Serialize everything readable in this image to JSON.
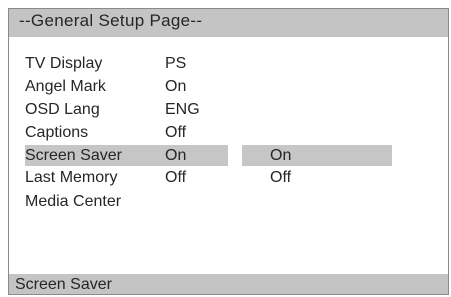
{
  "title": "--General Setup Page--",
  "menu": [
    {
      "label": "TV Display",
      "value": "PS"
    },
    {
      "label": "Angel Mark",
      "value": "On"
    },
    {
      "label": "OSD Lang",
      "value": "ENG"
    },
    {
      "label": "Captions",
      "value": "Off"
    },
    {
      "label": "Screen Saver",
      "value": "On"
    },
    {
      "label": "Last Memory",
      "value": "Off"
    },
    {
      "label": "Media Center",
      "value": ""
    }
  ],
  "submenu": [
    "On",
    "Off"
  ],
  "selected_item": "Screen Saver",
  "selected_option": "On",
  "status": "Screen Saver",
  "colors": {
    "bar_background": "#c4c4c4",
    "highlight": "#c6c6c6",
    "text": "#262626",
    "background": "#ffffff"
  }
}
